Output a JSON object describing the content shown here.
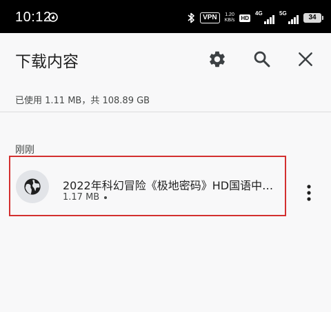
{
  "status_bar": {
    "time": "10:12",
    "vpn": "VPN",
    "speed_value": "1.20",
    "speed_unit": "KB/s",
    "hd_label": "HD",
    "sim1_tag": "4G",
    "sim2_tag": "5G",
    "battery": "34"
  },
  "app_bar": {
    "title": "下载内容",
    "icons": [
      "settings-icon",
      "search-icon",
      "close-icon"
    ]
  },
  "storage_info": "已使用 1.11 MB，共 108.89 GB",
  "section_header": "刚刚",
  "downloads": [
    {
      "title": "2022年科幻冒险《极地密码》HD国语中…",
      "size": "1.17 MB",
      "icon": "globe-icon"
    }
  ],
  "colors": {
    "highlight_border": "#d32f2f",
    "background": "#f8f8f9",
    "icon_dark": "#3c4043"
  }
}
